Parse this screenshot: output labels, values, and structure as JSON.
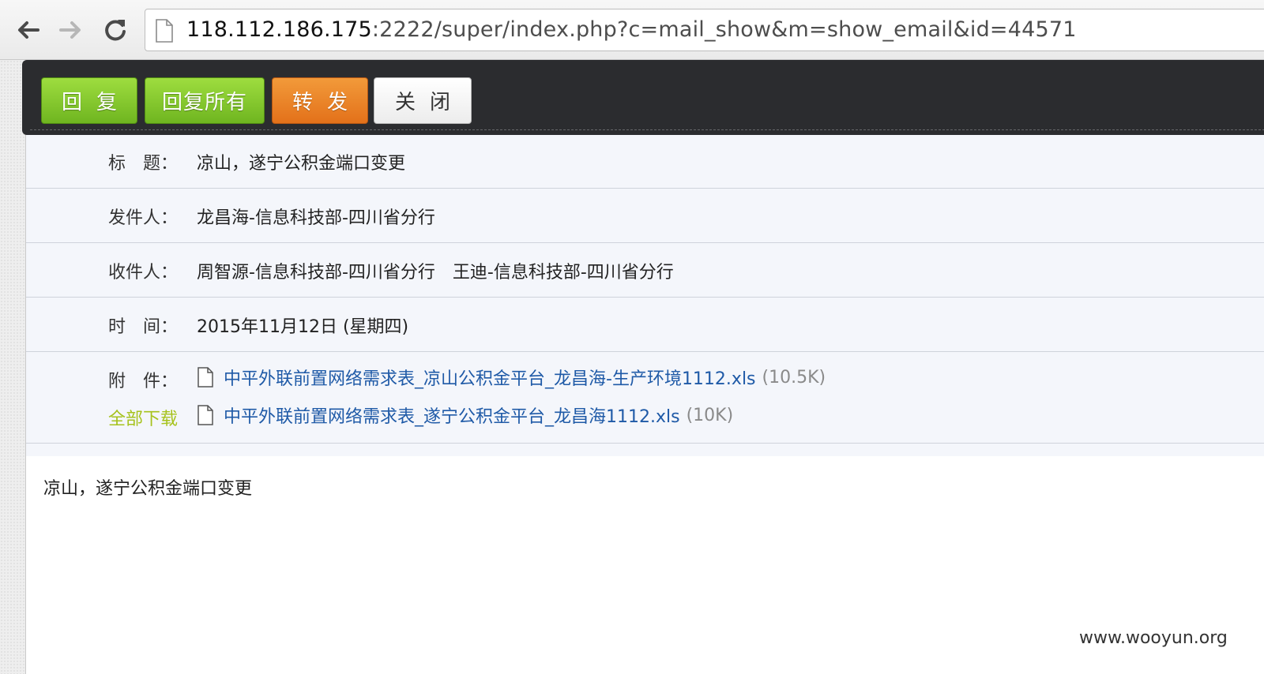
{
  "browser": {
    "url_host": "118.112.186.175",
    "url_path": ":2222/super/index.php?c=mail_show&m=show_email&id=44571",
    "icons": [
      "back-arrow-icon",
      "forward-arrow-icon",
      "reload-icon",
      "page-icon"
    ]
  },
  "toolbar": {
    "reply": "回复",
    "reply_all": "回复所有",
    "forward": "转发",
    "close": "关闭"
  },
  "mail": {
    "subject_label": "标　题：",
    "subject": "凉山，遂宁公积金端口变更",
    "sender_label": "发件人：",
    "sender": "龙昌海-信息科技部-四川省分行",
    "recipients_label": "收件人：",
    "recipients": "周智源-信息科技部-四川省分行　王迪-信息科技部-四川省分行",
    "time_label": "时　间：",
    "time": "2015年11月12日 (星期四)",
    "attachments_label": "附　件：",
    "download_all": "全部下载",
    "attachments": [
      {
        "name": "中平外联前置网络需求表_凉山公积金平台_龙昌海-生产环境1112.xls",
        "size": "(10.5K)"
      },
      {
        "name": "中平外联前置网络需求表_遂宁公积金平台_龙昌海1112.xls",
        "size": "(10K)"
      }
    ],
    "body": "凉山，遂宁公积金端口变更"
  },
  "watermark": "www.wooyun.org",
  "colors": {
    "toolbar_bg": "#2b2c2f",
    "green_button": "#7cc52a",
    "orange_button": "#e8791f",
    "link": "#1f5aa7",
    "download_all": "#a6c21c",
    "header_bg": "#f4f6fb"
  }
}
